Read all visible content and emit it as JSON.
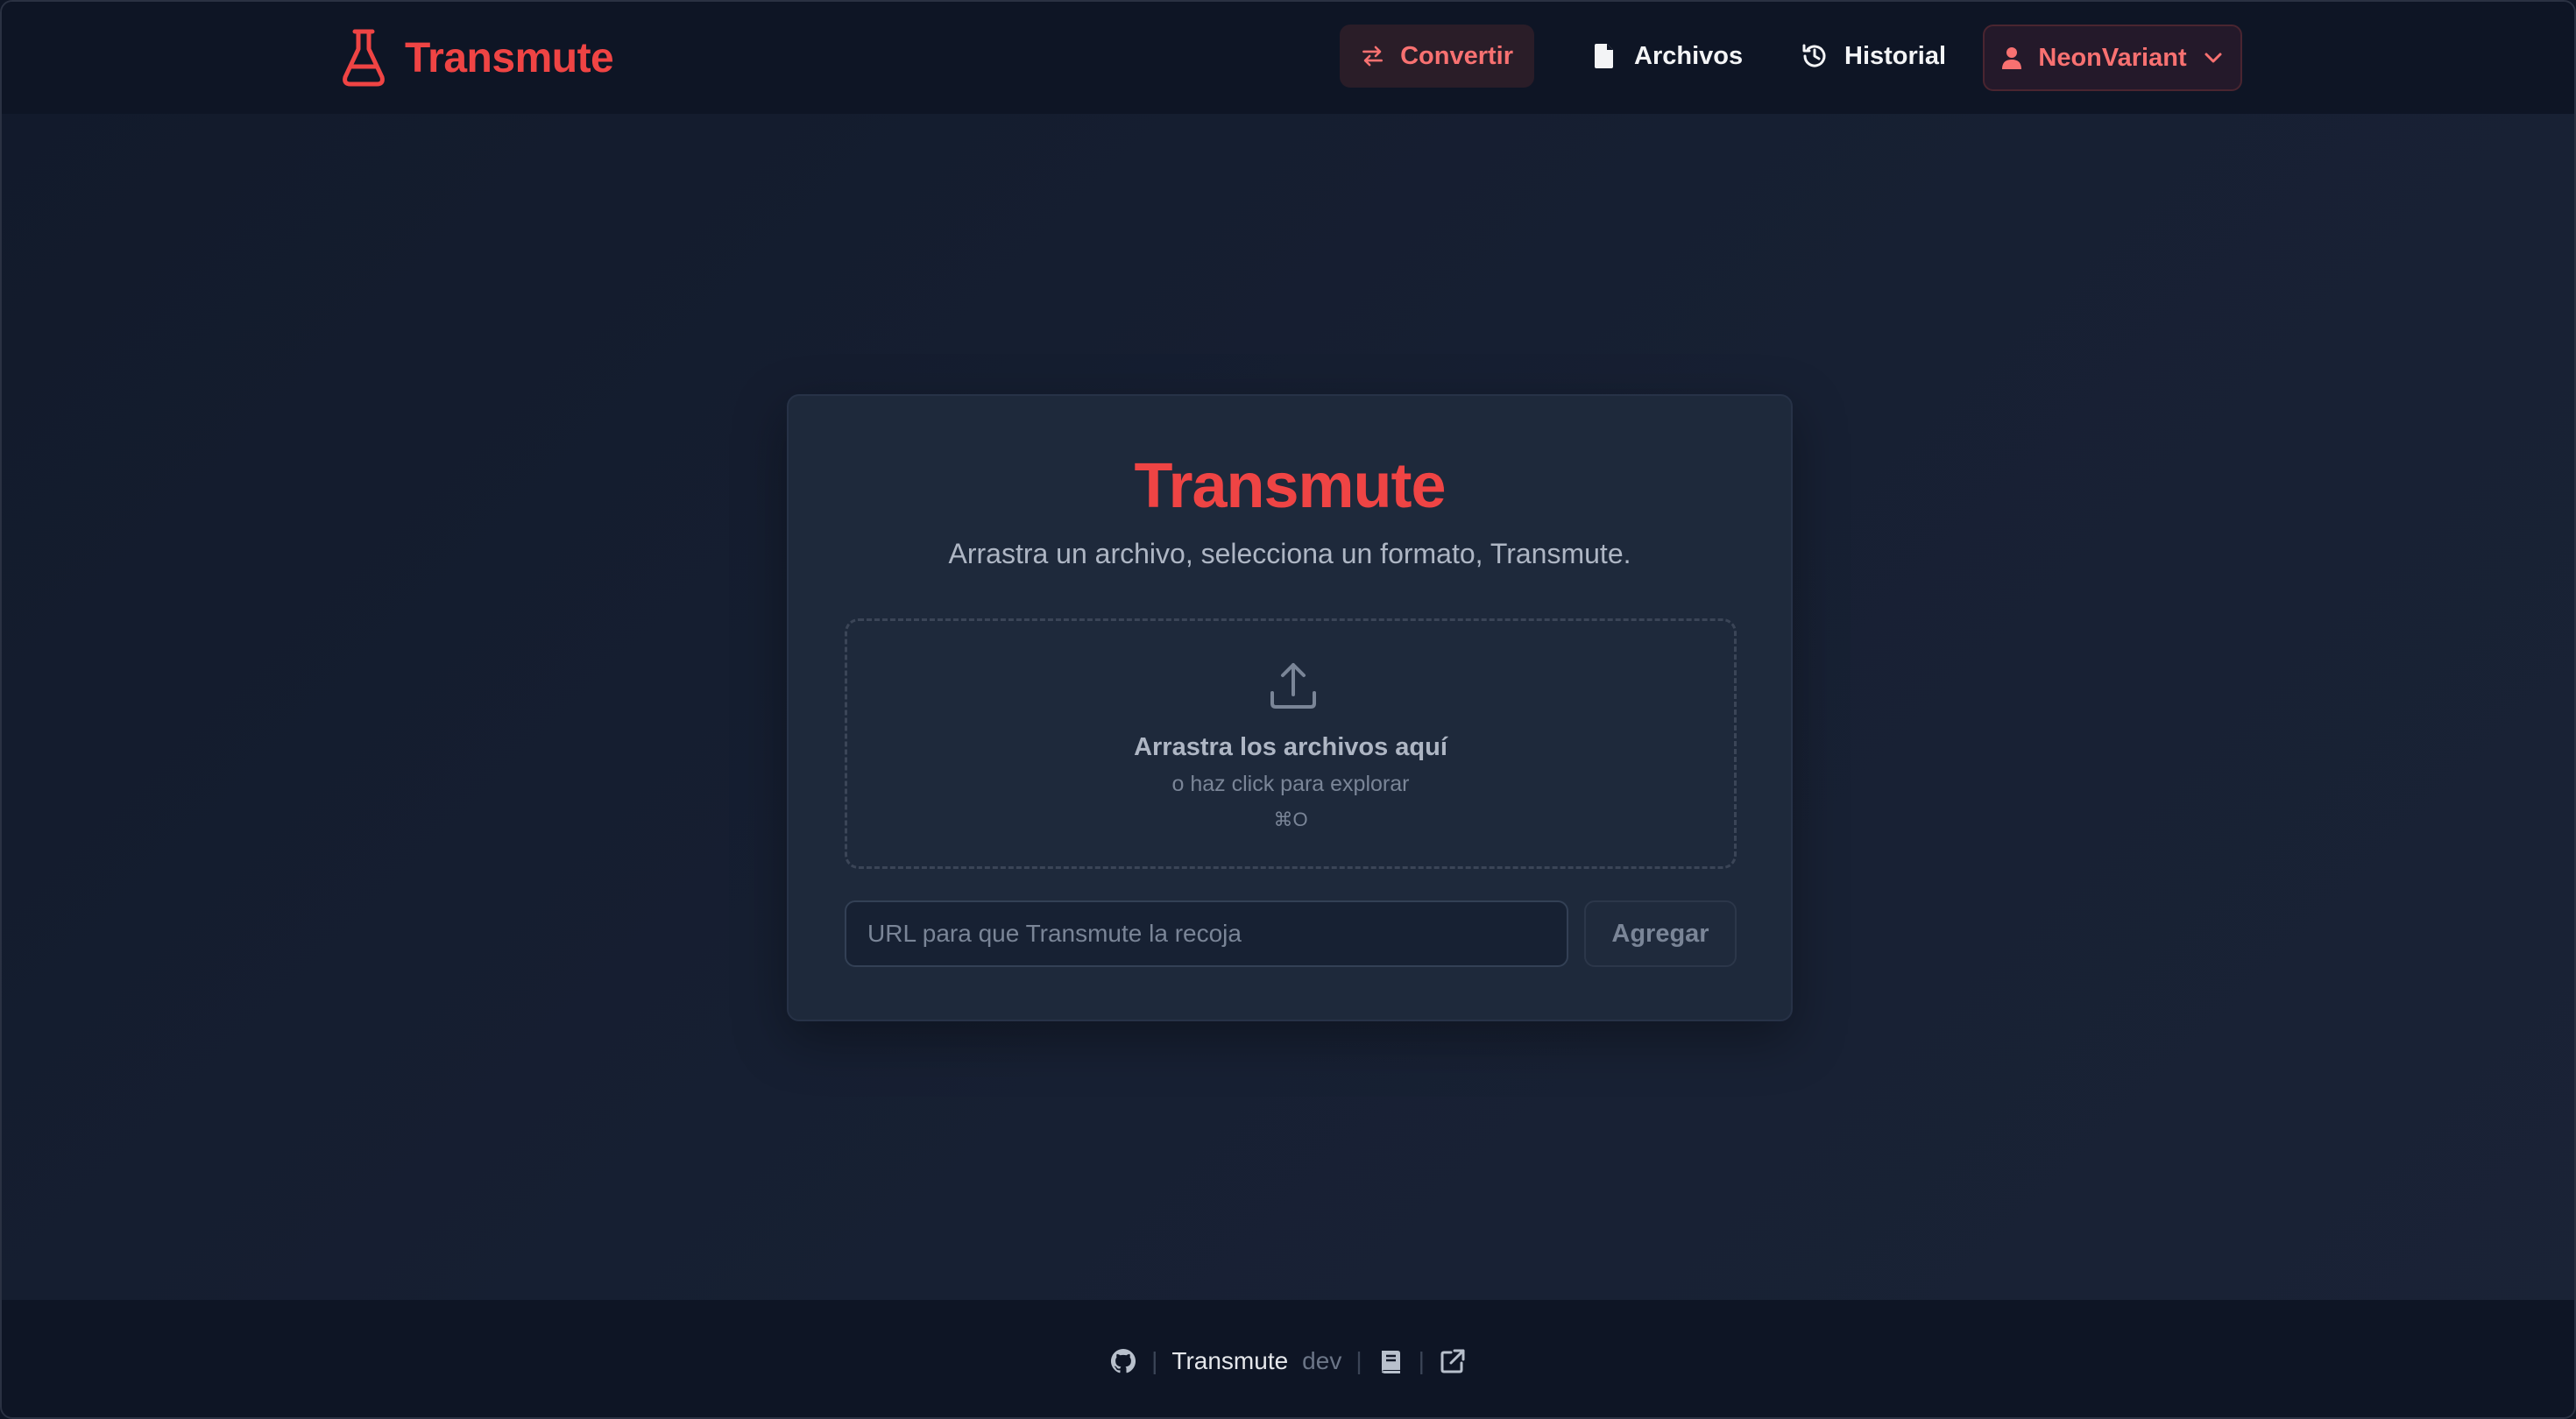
{
  "header": {
    "brand": "Transmute",
    "nav": [
      {
        "label": "Convertir",
        "icon": "arrows-exchange-icon",
        "active": true
      },
      {
        "label": "Archivos",
        "icon": "file-icon",
        "active": false
      },
      {
        "label": "Historial",
        "icon": "history-icon",
        "active": false
      }
    ],
    "user": {
      "label": "NeonVariant",
      "icon": "user-icon"
    }
  },
  "card": {
    "title": "Transmute",
    "subtitle": "Arrastra un archivo, selecciona un formato, Transmute.",
    "dropzone": {
      "title": "Arrastra los archivos aquí",
      "subtitle": "o haz click para explorar",
      "shortcut": "⌘O"
    },
    "url_input": {
      "value": "",
      "placeholder": "URL para que Transmute la recoja"
    },
    "add_label": "Agregar"
  },
  "footer": {
    "name": "Transmute",
    "version": "dev",
    "separator": "|"
  },
  "colors": {
    "accent": "#ef4444",
    "background": "#121a2b",
    "card": "#1e293b"
  }
}
